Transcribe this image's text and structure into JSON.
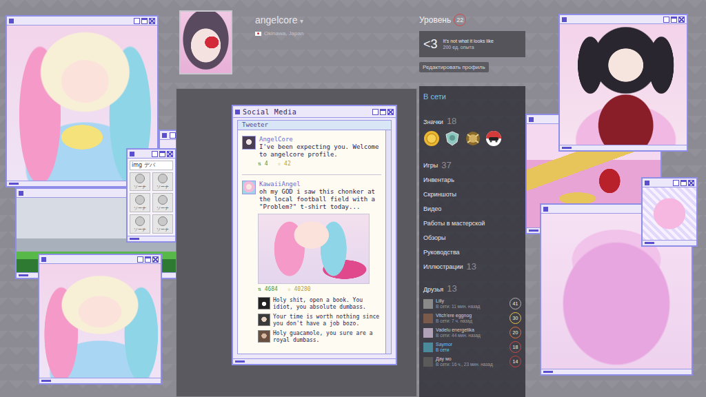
{
  "profile": {
    "name": "angelcore",
    "menu_arrow": "▾",
    "location": "Okinawa, Japan"
  },
  "level": {
    "label": "Уровень",
    "value": "22"
  },
  "featured_badge": {
    "icon": "<3",
    "title": "It's not what it looks like",
    "xp": "200 ед. опыта"
  },
  "edit_button": "Редактировать профиль",
  "status": "В сети",
  "badges": {
    "label": "Значки",
    "count": "18"
  },
  "nav": [
    {
      "label": "Игры",
      "count": "37"
    },
    {
      "label": "Инвентарь"
    },
    {
      "label": "Скриншоты"
    },
    {
      "label": "Видео"
    },
    {
      "label": "Работы в мастерской"
    },
    {
      "label": "Обзоры"
    },
    {
      "label": "Руководства"
    },
    {
      "label": "Иллюстрации",
      "count": "13"
    }
  ],
  "friends": {
    "label": "Друзья",
    "count": "13",
    "items": [
      {
        "name": "Lilly",
        "status": "В сети: 11 мин. назад",
        "level": "41",
        "online": false,
        "color": "#b0b0b6"
      },
      {
        "name": "Vitch'ere eggnog",
        "status": "В сети: 7 ч. назад",
        "level": "30",
        "online": false,
        "color": "#e8c44a"
      },
      {
        "name": "Vadelu energetika",
        "status": "В сети: 44 мин. назад",
        "level": "20",
        "online": false,
        "color": "#e0703a"
      },
      {
        "name": "Saymor",
        "status": "В сети",
        "level": "18",
        "online": true,
        "color": "#d04a4a"
      },
      {
        "name": "Дау мо",
        "status": "В сети: 16 ч., 23 мин. назад",
        "level": "14",
        "online": false,
        "color": "#c94040"
      }
    ]
  },
  "img_window": {
    "title": "img デバ",
    "buttons": [
      "ソーナ",
      "ソーナ",
      "ソーナ",
      "ソーナ",
      "ソーナ",
      "ソーナ"
    ]
  },
  "social_window": {
    "title": "Social Media",
    "tab": "Tweeter",
    "posts": [
      {
        "user": "AngelCore",
        "kind": "text",
        "text": "I've been expecting you. Welcome to angelcore profile.",
        "retweet_icon": "⇅",
        "retweets": "4",
        "like_icon": "☆",
        "likes": "42",
        "replies": []
      },
      {
        "user": "KawaiiAngel",
        "kind": "image",
        "text": "oh my GOD i saw this chonker at the local football field with a \"Problem?\" t-shirt today...",
        "retweet_icon": "⇅",
        "retweets": "4684",
        "like_icon": "☆",
        "likes": "40280",
        "replies": [
          "Holy shit, open a book. You idiot, you absolute dumbass.",
          "Your time is worth nothing since you don't have a job bozo.",
          "Holy guacamole, you sure are a royal dumbass."
        ]
      }
    ]
  }
}
